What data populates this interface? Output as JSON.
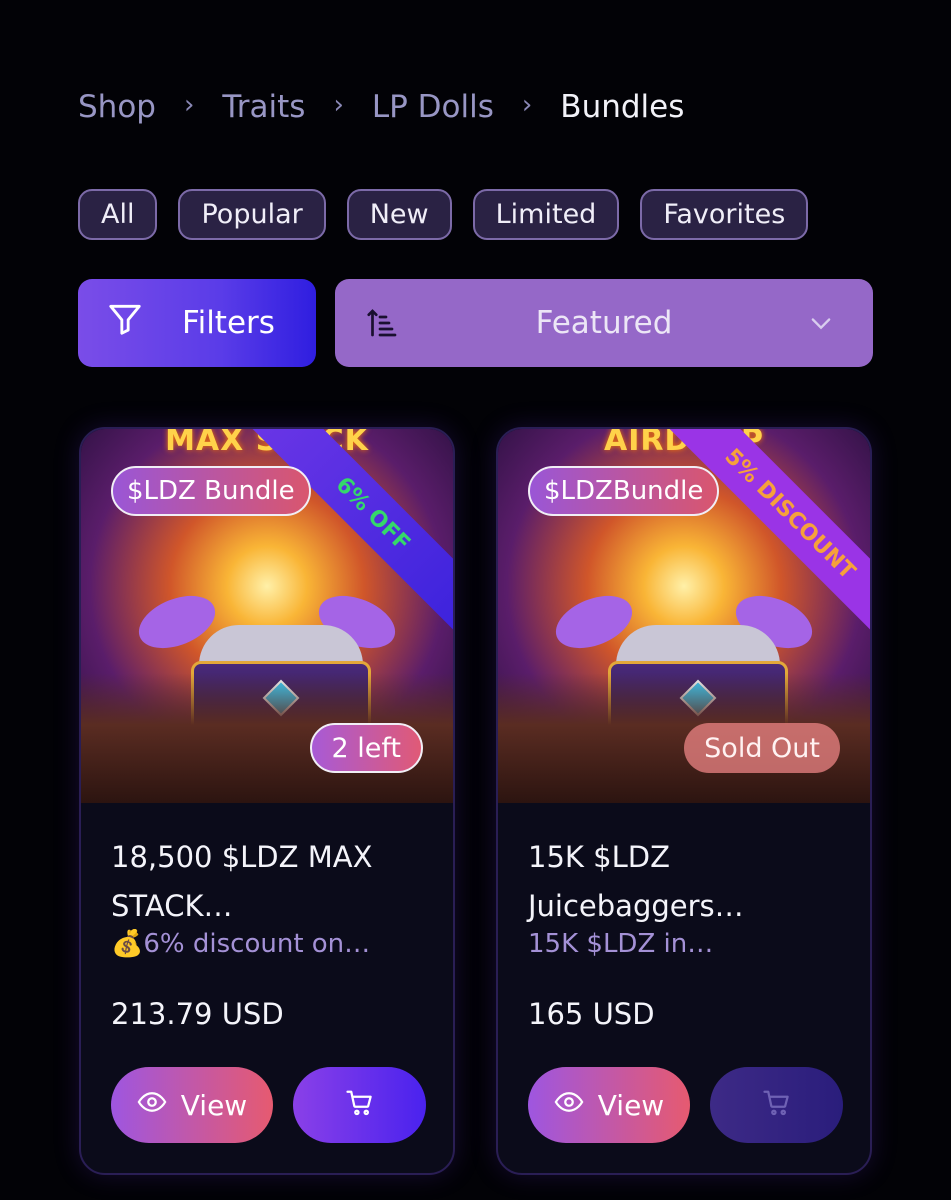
{
  "breadcrumb": {
    "items": [
      "Shop",
      "Traits",
      "LP Dolls",
      "Bundles"
    ],
    "separator": "›"
  },
  "category_chips": [
    "All",
    "Popular",
    "New",
    "Limited",
    "Favorites"
  ],
  "toolbar": {
    "filters_label": "Filters",
    "sort_selected": "Featured",
    "filter_icon": "funnel-icon",
    "sort_icon": "sort-ascending-icon",
    "dropdown_icon": "chevron-down-icon"
  },
  "products": [
    {
      "image_banner": "MAX STACK",
      "tag": "$LDZ Bundle",
      "ribbon": "6% OFF",
      "stock": "2 left",
      "title": "18,500 $LDZ MAX STACK…",
      "subtitle_icon": "money-bag-icon",
      "subtitle": "6% discount on…",
      "price": "213.79 USD",
      "view_label": "View",
      "cart_enabled": true
    },
    {
      "image_banner": "AIRDROP",
      "tag": "$LDZBundle",
      "ribbon": "5% DISCOUNT",
      "stock": "Sold Out",
      "title": "15K $LDZ Juicebaggers…",
      "subtitle": "15K $LDZ in…",
      "price": "165 USD",
      "view_label": "View",
      "cart_enabled": false
    }
  ],
  "colors": {
    "background": "#020206",
    "accent_purple": "#7a4de8",
    "sort_bg": "#9568c8",
    "card_bg": "#0b0b1a",
    "ribbon_a_text": "#35d86a",
    "ribbon_b_text": "#f6a13a"
  }
}
